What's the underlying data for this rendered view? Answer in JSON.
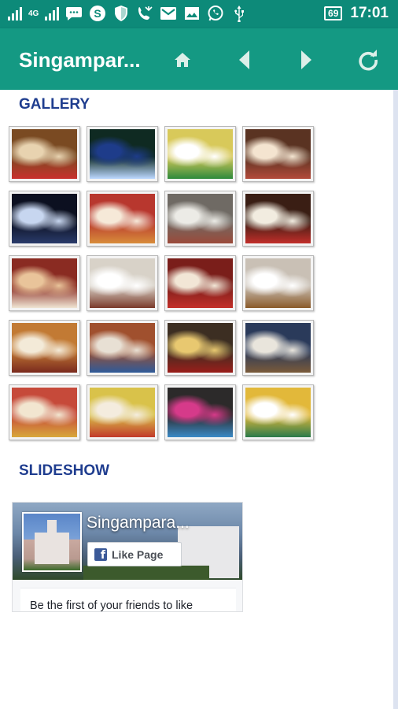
{
  "status_bar": {
    "network_label": "4G",
    "battery": "69",
    "time": "17:01"
  },
  "app_bar": {
    "title": "Singampar...",
    "icons": [
      "home-icon",
      "back-arrow-icon",
      "forward-arrow-icon",
      "refresh-icon"
    ]
  },
  "gallery": {
    "heading": "GALLERY",
    "thumbnails": [
      {
        "c1": "#7a4a22",
        "c2": "#e8d3b0",
        "c3": "#c9302c"
      },
      {
        "c1": "#0f2a22",
        "c2": "#1e3c8a",
        "c3": "#bcd8ff"
      },
      {
        "c1": "#d8c95a",
        "c2": "#ffffff",
        "c3": "#2e8a3c"
      },
      {
        "c1": "#5a3322",
        "c2": "#f4e4d0",
        "c3": "#b34a3a"
      },
      {
        "c1": "#0c1020",
        "c2": "#c7d6f0",
        "c3": "#2a3b6b"
      },
      {
        "c1": "#b8372e",
        "c2": "#f6e9d8",
        "c3": "#d88d3a"
      },
      {
        "c1": "#6f6a64",
        "c2": "#ecebe6",
        "c3": "#9b4a3a"
      },
      {
        "c1": "#3a1e14",
        "c2": "#f2ece0",
        "c3": "#c22e2a"
      },
      {
        "c1": "#8a2b22",
        "c2": "#e9c49a",
        "c3": "#f0e6d4"
      },
      {
        "c1": "#d8d2c8",
        "c2": "#ffffff",
        "c3": "#7a3a2a"
      },
      {
        "c1": "#7a1e1a",
        "c2": "#f2e6d6",
        "c3": "#c4302a"
      },
      {
        "c1": "#c9c0b5",
        "c2": "#ffffff",
        "c3": "#8a5a2a"
      },
      {
        "c1": "#c27a34",
        "c2": "#f3ead8",
        "c3": "#7a2a1e"
      },
      {
        "c1": "#a0502e",
        "c2": "#e8e0d4",
        "c3": "#2e5a9a"
      },
      {
        "c1": "#3c2e22",
        "c2": "#e8c870",
        "c3": "#9a1e1a"
      },
      {
        "c1": "#2a3a5a",
        "c2": "#e9e5dc",
        "c3": "#7a5a3a"
      },
      {
        "c1": "#c64a3a",
        "c2": "#f2e6d0",
        "c3": "#d8a83a"
      },
      {
        "c1": "#d9c24a",
        "c2": "#f4ecde",
        "c3": "#c23a2a"
      },
      {
        "c1": "#2c2a2a",
        "c2": "#d63a8a",
        "c3": "#3a8ac6"
      },
      {
        "c1": "#e2b83a",
        "c2": "#ffffff",
        "c3": "#2a7a4a"
      }
    ]
  },
  "slideshow": {
    "heading": "SLIDESHOW"
  },
  "fb_widget": {
    "page_name": "Singampara...",
    "like_button": "Like Page",
    "friends_text": "Be the first of your friends to like",
    "brand_color": "#3b5998"
  }
}
